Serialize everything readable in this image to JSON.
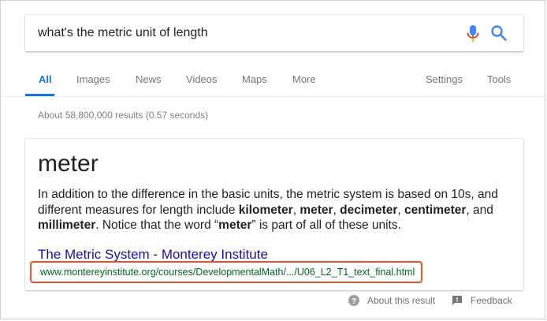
{
  "search": {
    "query": "what's the metric unit of length"
  },
  "tabs": [
    {
      "label": "All",
      "active": true
    },
    {
      "label": "Images"
    },
    {
      "label": "News"
    },
    {
      "label": "Videos"
    },
    {
      "label": "Maps"
    },
    {
      "label": "More"
    }
  ],
  "tools": {
    "settings_label": "Settings",
    "tools_label": "Tools"
  },
  "stats": "About 58,800,000 results (0.57 seconds)",
  "answer": {
    "title": "meter",
    "snippet_parts": [
      "In addition to the difference in the basic units, the metric system is based on 10s, and different measures for length include ",
      "kilometer",
      ", ",
      "meter",
      ", ",
      "decimeter",
      ", ",
      "centimeter",
      ", and ",
      "millimeter",
      ". Notice that the word “",
      "meter",
      "” is part of all of these units."
    ],
    "result_title_part1": "The Metric System",
    "result_title_sep": " - ",
    "result_title_part2": "Monterey Institute",
    "result_url": "www.montereyinstitute.org/courses/DevelopmentalMath/.../U06_L2_T1_text_final.html"
  },
  "footer": {
    "about_label": "About this result",
    "feedback_label": "Feedback"
  },
  "colors": {
    "accent_blue": "#1a73e8",
    "link_blue": "#1a0dab",
    "url_green": "#006621",
    "highlight_orange": "#e8542a"
  },
  "icons": {
    "mic": "microphone-icon",
    "search": "magnifier-icon",
    "about": "question-circle-icon",
    "feedback": "feedback-icon"
  }
}
